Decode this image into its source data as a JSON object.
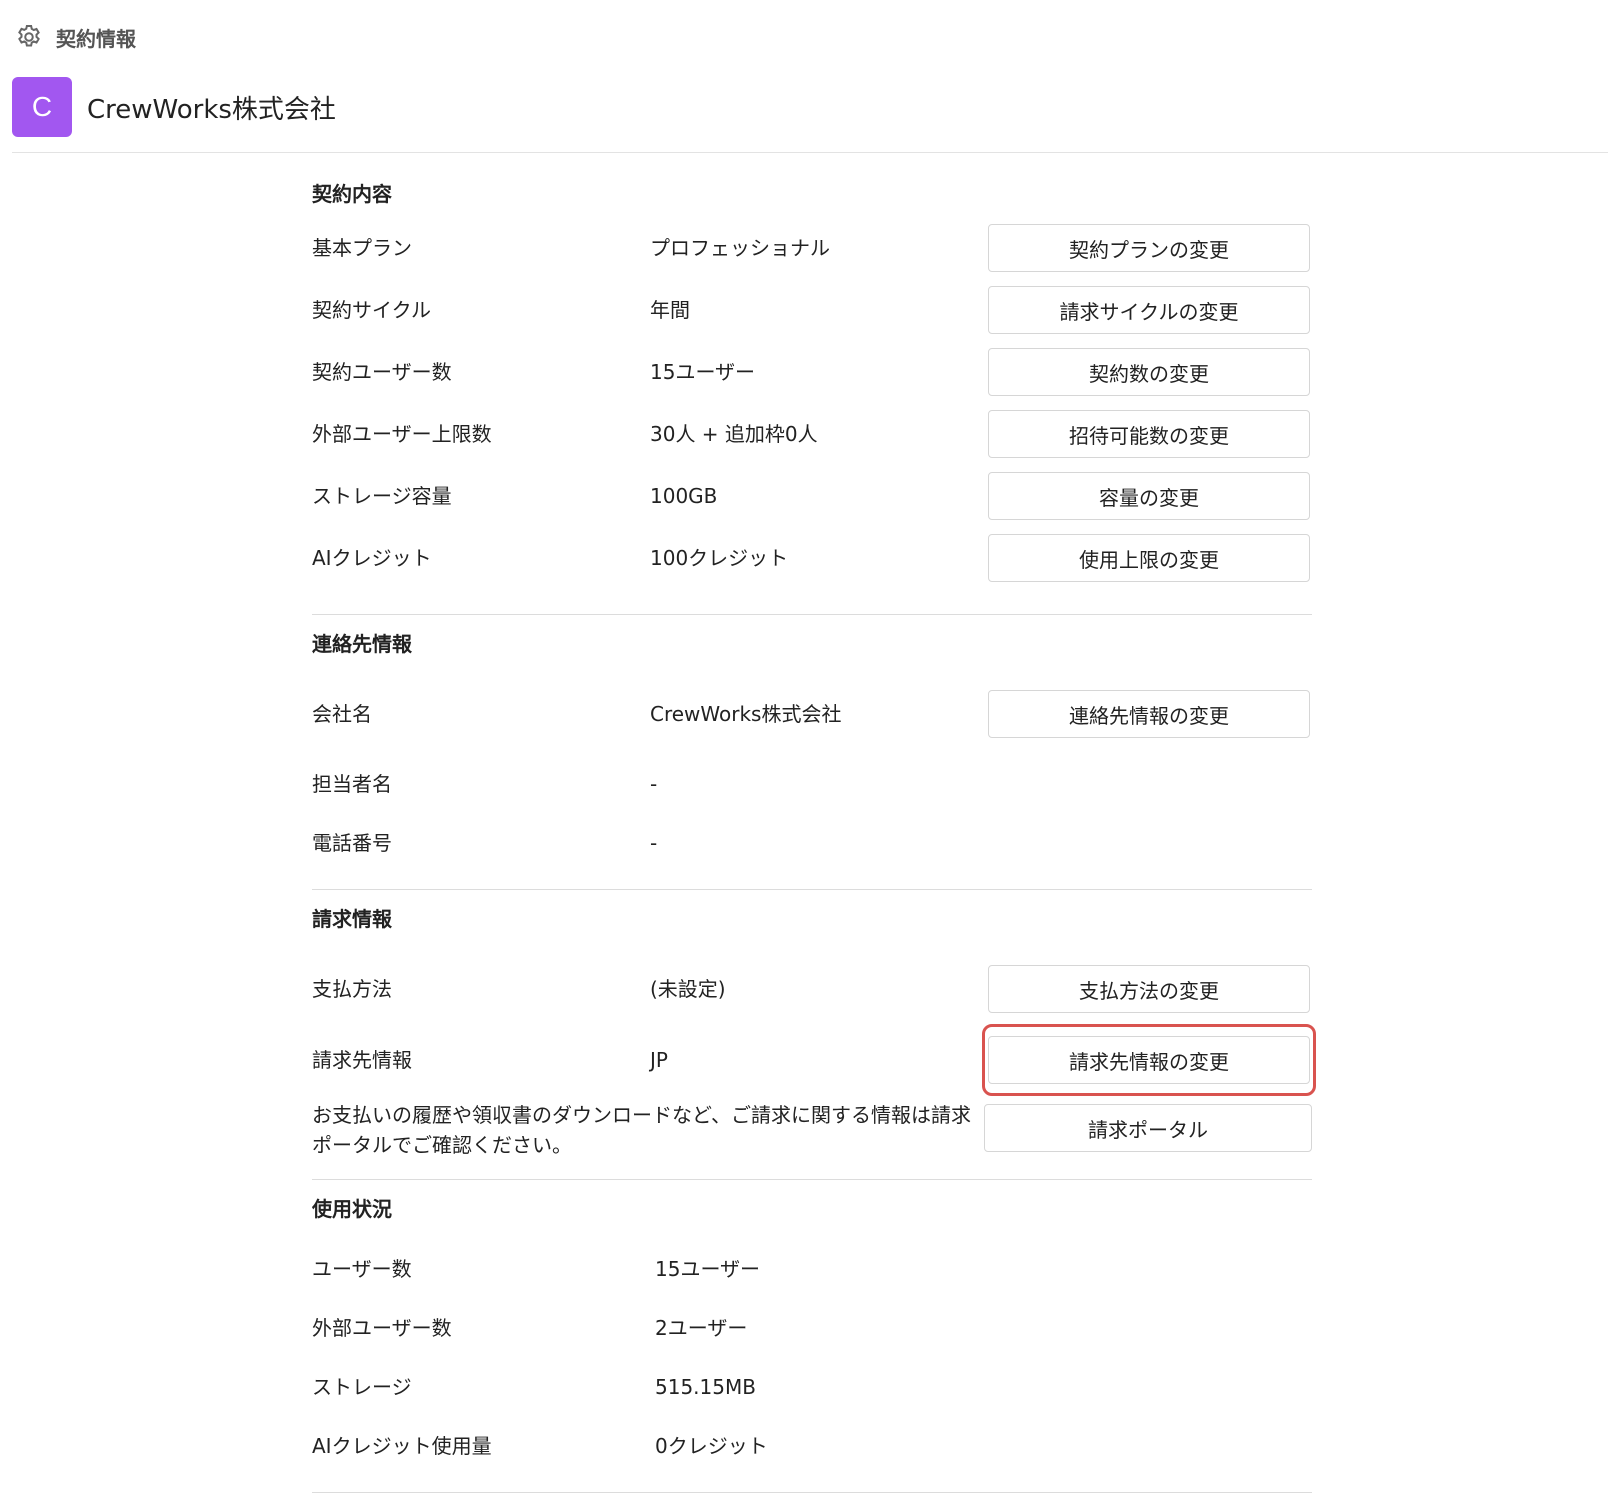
{
  "topbar": {
    "title": "契約情報",
    "icon": "gear-icon"
  },
  "org": {
    "avatar_letter": "C",
    "avatar_color": "#a257f0",
    "name": "CrewWorks株式会社"
  },
  "contract": {
    "title": "契約内容",
    "rows": [
      {
        "label": "基本プラン",
        "value": "プロフェッショナル",
        "button": "契約プランの変更"
      },
      {
        "label": "契約サイクル",
        "value": "年間",
        "button": "請求サイクルの変更"
      },
      {
        "label": "契約ユーザー数",
        "value": "15ユーザー",
        "button": "契約数の変更"
      },
      {
        "label": "外部ユーザー上限数",
        "value": "30人 + 追加枠0人",
        "button": "招待可能数の変更"
      },
      {
        "label": "ストレージ容量",
        "value": "100GB",
        "button": "容量の変更"
      },
      {
        "label": "AIクレジット",
        "value": "100クレジット",
        "button": "使用上限の変更"
      }
    ]
  },
  "contact": {
    "title": "連絡先情報",
    "rows": [
      {
        "label": "会社名",
        "value": "CrewWorks株式会社",
        "button": "連絡先情報の変更"
      },
      {
        "label": "担当者名",
        "value": "-"
      },
      {
        "label": "電話番号",
        "value": "-"
      }
    ]
  },
  "billing": {
    "title": "請求情報",
    "rows": [
      {
        "label": "支払方法",
        "value": "(未設定)",
        "button": "支払方法の変更"
      },
      {
        "label": "請求先情報",
        "value": "JP",
        "button": "請求先情報の変更"
      }
    ],
    "note": "お支払いの履歴や領収書のダウンロードなど、ご請求に関する情報は請求ポータルでご確認ください。",
    "portal_button": "請求ポータル",
    "highlight_color": "#d9534f"
  },
  "usage": {
    "title": "使用状況",
    "rows": [
      {
        "label": "ユーザー数",
        "value": "15ユーザー"
      },
      {
        "label": "外部ユーザー数",
        "value": "2ユーザー"
      },
      {
        "label": "ストレージ",
        "value": "515.15MB"
      },
      {
        "label": "AIクレジット使用量",
        "value": "0クレジット"
      }
    ]
  }
}
